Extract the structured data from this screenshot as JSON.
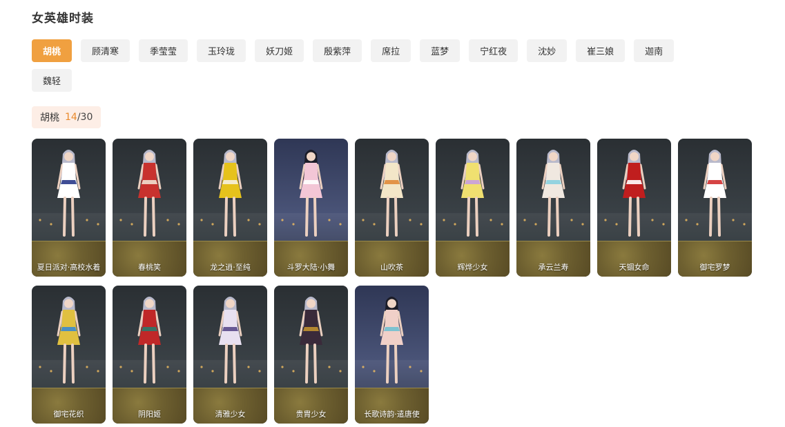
{
  "page": {
    "title": "女英雄时装"
  },
  "filters": [
    {
      "label": "胡桃",
      "active": true
    },
    {
      "label": "顾清寒",
      "active": false
    },
    {
      "label": "季莹莹",
      "active": false
    },
    {
      "label": "玉玲珑",
      "active": false
    },
    {
      "label": "妖刀姬",
      "active": false
    },
    {
      "label": "殷紫萍",
      "active": false
    },
    {
      "label": "席拉",
      "active": false
    },
    {
      "label": "蓝梦",
      "active": false
    },
    {
      "label": "宁红夜",
      "active": false
    },
    {
      "label": "沈妙",
      "active": false
    },
    {
      "label": "崔三娘",
      "active": false
    },
    {
      "label": "迦南",
      "active": false
    },
    {
      "label": "魏轻",
      "active": false
    }
  ],
  "counter": {
    "hero": "胡桃",
    "current": "14",
    "separator": "/",
    "total": "30"
  },
  "skins": [
    {
      "name": "夏日派对·高校水着",
      "outfit": "#ffffff",
      "accent": "#2a3a8a",
      "bg": "dark"
    },
    {
      "name": "春桃笑",
      "outfit": "#c8322e",
      "accent": "#f0e0d0",
      "bg": "dark"
    },
    {
      "name": "龙之逍·至纯",
      "outfit": "#e6c21c",
      "accent": "#f5f0e0",
      "bg": "dark"
    },
    {
      "name": "斗罗大陆·小舞",
      "outfit": "#f3c6d6",
      "accent": "#ffffff",
      "bg": "blue"
    },
    {
      "name": "山吹茶",
      "outfit": "#f3e6c8",
      "accent": "#e08a3a",
      "bg": "dark"
    },
    {
      "name": "辉烨少女",
      "outfit": "#f0e070",
      "accent": "#c8a0e0",
      "bg": "dark"
    },
    {
      "name": "承云兰寿",
      "outfit": "#f0e8e0",
      "accent": "#8ad0e0",
      "bg": "dark"
    },
    {
      "name": "天锢女命",
      "outfit": "#c01e1e",
      "accent": "#ffffff",
      "bg": "dark"
    },
    {
      "name": "御宅罗梦",
      "outfit": "#ffffff",
      "accent": "#d03030",
      "bg": "dark"
    },
    {
      "name": "御宅花织",
      "outfit": "#e0c040",
      "accent": "#3a8ad0",
      "bg": "dark"
    },
    {
      "name": "阴阳姬",
      "outfit": "#c02828",
      "accent": "#2a7a6a",
      "bg": "dark"
    },
    {
      "name": "清雅少女",
      "outfit": "#e8e0f0",
      "accent": "#5a4a8a",
      "bg": "dark"
    },
    {
      "name": "贵胄少女",
      "outfit": "#3a2a3a",
      "accent": "#c09030",
      "bg": "dark"
    },
    {
      "name": "长歌诗韵·遣唐使",
      "outfit": "#f0d0c8",
      "accent": "#70c0d0",
      "bg": "blue"
    }
  ]
}
